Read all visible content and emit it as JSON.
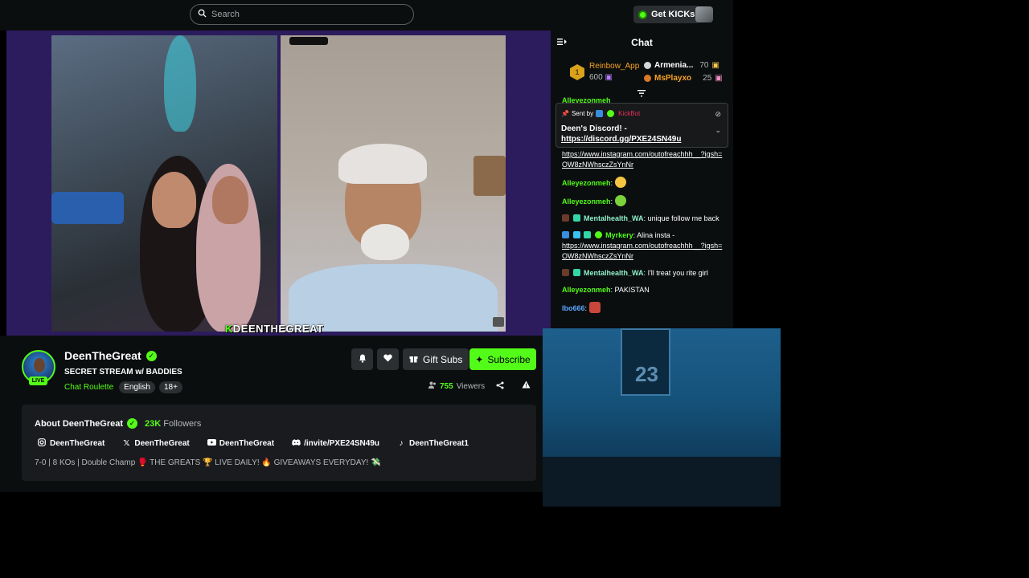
{
  "topbar": {
    "search_placeholder": "Search",
    "get_kicks_label": "Get KICKs"
  },
  "player": {
    "streamer_overlay": "DEENTHEGREAT",
    "streamer_overlay_prefix": "K"
  },
  "channel": {
    "name": "DeenTheGreat",
    "live_label": "LIVE",
    "stream_title": "SECRET STREAM w/ BADDIES",
    "category": "Chat Roulette",
    "tags": [
      "English",
      "18+"
    ],
    "viewers_count": "755",
    "viewers_label": "Viewers",
    "gift_subs_label": "Gift Subs",
    "subscribe_label": "Subscribe"
  },
  "about": {
    "heading": "About DeenTheGreat",
    "followers_count": "23K",
    "followers_label": "Followers",
    "socials": [
      {
        "icon": "instagram-icon",
        "label": "DeenTheGreat"
      },
      {
        "icon": "x-icon",
        "label": "DeenTheGreat"
      },
      {
        "icon": "youtube-icon",
        "label": "DeenTheGreat"
      },
      {
        "icon": "discord-icon",
        "label": "/invite/PXE24SN49u"
      },
      {
        "icon": "tiktok-icon",
        "label": "DeenTheGreat1"
      }
    ],
    "bio": "7-0 | 8 KOs | Double Champ 🥊 THE GREATS 🏆 LIVE DAILY! 🔥 GIVEAWAYS EVERYDAY! 💸"
  },
  "chat": {
    "title": "Chat",
    "leaderboard": {
      "first": {
        "rank": "1",
        "name": "Reinbow_App",
        "amount": "600"
      },
      "second": {
        "name": "Armenia...",
        "amount": "70"
      },
      "third": {
        "name": "MsPlayxo",
        "amount": "25"
      }
    },
    "pinned": {
      "sent_by_label": "Sent by",
      "sender": "KickBot",
      "text": "Deen's Discord! -",
      "link": "https://discord.gg/PXE24SN49u"
    },
    "messages": [
      {
        "user": "",
        "text": "",
        "link": "https://www.instagram.com/outofreachhh__?igsh=OW8zNWhsczZsYnNr"
      },
      {
        "user": "Alleyezonmeh",
        "text": ""
      },
      {
        "user": "Alleyezonmeh",
        "text": ""
      },
      {
        "user": "Mentalhealth_WA",
        "text": "unique follow me back"
      },
      {
        "user": "Myrkery",
        "text": "Alina insta -",
        "link": "https://www.instagram.com/outofreachhh__?igsh=OW8zNWhsczZsYnNr"
      },
      {
        "user": "Mentalhealth_WA",
        "text": "I'll treat you rite girl"
      },
      {
        "user": "Alleyezonmeh",
        "text": "PAKISTAN"
      },
      {
        "user": "Ibo666",
        "text": ""
      }
    ],
    "top_partial_user": "Alleyezonmeh"
  },
  "pip": {
    "poster_number": "23"
  }
}
